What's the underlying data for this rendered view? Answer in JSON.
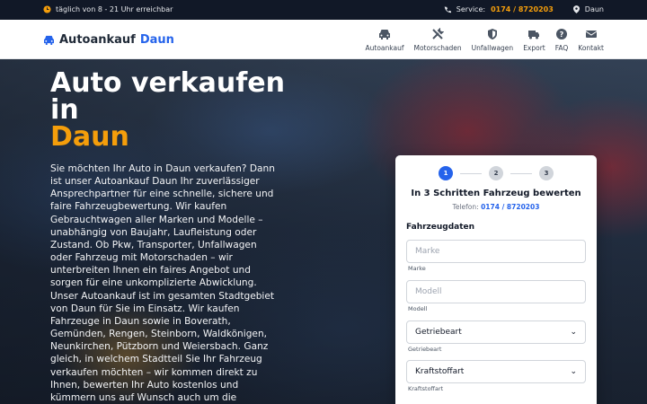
{
  "topbar": {
    "hours": "täglich von 8 - 21 Uhr erreichbar",
    "service_label": "Service:",
    "service_phone": "0174 / 8720203",
    "location": "Daun"
  },
  "header": {
    "brand": "Autoankauf",
    "city": "Daun",
    "nav": [
      {
        "label": "Autoankauf",
        "icon": "car-icon"
      },
      {
        "label": "Motorschaden",
        "icon": "tools-icon"
      },
      {
        "label": "Unfallwagen",
        "icon": "shield-icon"
      },
      {
        "label": "Export",
        "icon": "truck-icon"
      },
      {
        "label": "FAQ",
        "icon": "question-icon"
      },
      {
        "label": "Kontakt",
        "icon": "envelope-icon"
      }
    ]
  },
  "hero": {
    "title_line1": "Auto verkaufen",
    "title_line2": "in",
    "title_accent": "Daun",
    "text": "Sie möchten Ihr Auto in Daun verkaufen? Dann ist unser Autoankauf Daun Ihr zuverlässiger Ansprechpartner für eine schnelle, sichere und faire Fahrzeugbewertung. Wir kaufen Gebrauchtwagen aller Marken und Modelle – unabhängig von Baujahr, Laufleistung oder Zustand. Ob Pkw, Transporter, Unfallwagen oder Fahrzeug mit Motorschaden – wir unterbreiten Ihnen ein faires Angebot und sorgen für eine unkomplizierte Abwicklung. Unser Autoankauf ist im gesamten Stadtgebiet von Daun für Sie im Einsatz. Wir kaufen Fahrzeuge in Daun sowie in Boverath, Gemünden, Rengen, Steinborn, Waldkönigen, Neunkirchen, Pützborn und Weiersbach. Ganz gleich, in welchem Stadtteil Sie Ihr Fahrzeug verkaufen möchten – wir kommen direkt zu Ihnen, bewerten Ihr Auto kostenlos und kümmern uns auf Wunsch auch um die Abmeldung."
  },
  "form": {
    "steps": [
      "1",
      "2",
      "3"
    ],
    "active_step": 1,
    "title": "In 3 Schritten Fahrzeug bewerten",
    "phone_label": "Telefon:",
    "phone": "0174 / 8720203",
    "section": "Fahrzeugdaten",
    "fields": {
      "marke": {
        "placeholder": "Marke",
        "caption": "Marke"
      },
      "modell": {
        "placeholder": "Modell",
        "caption": "Modell"
      },
      "getriebe": {
        "value": "Getriebeart",
        "caption": "Getriebeart"
      },
      "kraftstoff": {
        "value": "Kraftstoffart",
        "caption": "Kraftstoffart"
      }
    }
  },
  "colors": {
    "accent": "#f59e0b",
    "brand": "#2563eb",
    "topbar": "#111827"
  }
}
